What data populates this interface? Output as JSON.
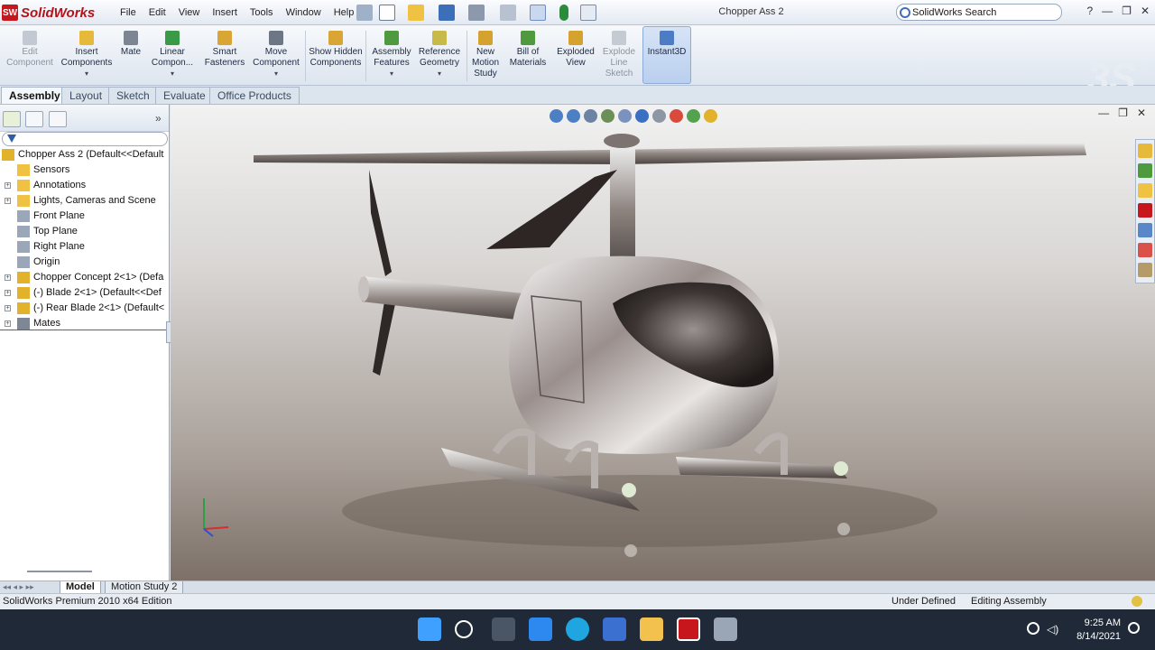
{
  "app": {
    "logo_text": "SolidWorks",
    "logo_badge": "SW"
  },
  "menu": [
    "File",
    "Edit",
    "View",
    "Insert",
    "Tools",
    "Window",
    "Help"
  ],
  "document_title": "Chopper Ass 2",
  "search": {
    "placeholder": "SolidWorks Search"
  },
  "command_manager": [
    {
      "label": "Edit Component",
      "disabled": true
    },
    {
      "label": "Insert Components"
    },
    {
      "label": "Mate"
    },
    {
      "label": "Linear Compon..."
    },
    {
      "label": "Smart Fasteners"
    },
    {
      "label": "Move Component"
    },
    {
      "label": "Show Hidden Components"
    },
    {
      "label": "Assembly Features"
    },
    {
      "label": "Reference Geometry"
    },
    {
      "label": "New Motion Study"
    },
    {
      "label": "Bill of Materials"
    },
    {
      "label": "Exploded View"
    },
    {
      "label": "Explode Line Sketch",
      "disabled": true
    },
    {
      "label": "Instant3D"
    }
  ],
  "tabs": [
    "Assembly",
    "Layout",
    "Sketch",
    "Evaluate",
    "Office Products"
  ],
  "active_tab": "Assembly",
  "feature_tree": {
    "items": [
      {
        "label": "Chopper Ass 2  (Default<<Default",
        "icon": "assembly-icon",
        "expandable": false
      },
      {
        "label": "Sensors",
        "icon": "folder-icon",
        "expandable": false
      },
      {
        "label": "Annotations",
        "icon": "annotation-icon",
        "expandable": true
      },
      {
        "label": "Lights, Cameras and Scene",
        "icon": "lights-icon",
        "expandable": true
      },
      {
        "label": "Front Plane",
        "icon": "plane-icon",
        "expandable": false
      },
      {
        "label": "Top Plane",
        "icon": "plane-icon",
        "expandable": false
      },
      {
        "label": "Right Plane",
        "icon": "plane-icon",
        "expandable": false
      },
      {
        "label": "Origin",
        "icon": "origin-icon",
        "expandable": false
      },
      {
        "label": "Chopper Concept 2<1> (Defa",
        "icon": "part-icon",
        "expandable": true
      },
      {
        "label": "(-) Blade 2<1> (Default<<Def",
        "icon": "part-icon",
        "expandable": true
      },
      {
        "label": "(-) Rear Blade 2<1> (Default<",
        "icon": "part-icon",
        "expandable": true
      },
      {
        "label": "Mates",
        "icon": "mates-icon",
        "expandable": true
      }
    ]
  },
  "bottom_tabs": [
    "Model",
    "Motion Study 2"
  ],
  "status": {
    "edition": "SolidWorks Premium 2010 x64 Edition",
    "definition": "Under Defined",
    "mode": "Editing Assembly"
  },
  "taskbar": {
    "time": "9:25 AM",
    "date": "8/14/2021"
  },
  "colors": {
    "accent": "#c8161d",
    "selection": "#2a6bd0",
    "taskbar": "#1f2937"
  }
}
